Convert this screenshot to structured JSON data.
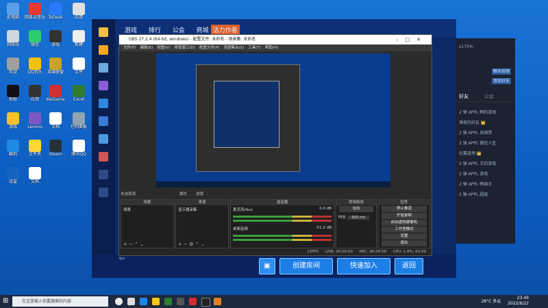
{
  "desktop": {
    "icons": [
      {
        "label": "此电脑",
        "color": "#5aa0e8"
      },
      {
        "label": "网易云音乐",
        "color": "#e53935"
      },
      {
        "label": "ToDesk",
        "color": "#2979ff"
      },
      {
        "label": "应用",
        "color": "#e0e0e0"
      },
      {
        "label": "回收站",
        "color": "#cfd8dc"
      },
      {
        "label": "微信",
        "color": "#2ecc71"
      },
      {
        "label": "游戏",
        "color": "#333"
      },
      {
        "label": "新建",
        "color": "#eee"
      },
      {
        "label": "欢迎",
        "color": "#9e9e9e"
      },
      {
        "label": "QQ音乐",
        "color": "#f4c20d"
      },
      {
        "label": "英雄联盟",
        "color": "#c9a227"
      },
      {
        "label": "文件",
        "color": "#fff"
      },
      {
        "label": "剪映",
        "color": "#111"
      },
      {
        "label": "应用",
        "color": "#333"
      },
      {
        "label": "WeGame",
        "color": "#d32f2f"
      },
      {
        "label": "Excel",
        "color": "#2e7d32"
      },
      {
        "label": "游戏",
        "color": "#fbc02d"
      },
      {
        "label": "Lenovo",
        "color": "#7e57c2"
      },
      {
        "label": "文档",
        "color": "#fff"
      },
      {
        "label": "控制面板",
        "color": "#90a4ae"
      },
      {
        "label": "酷狗",
        "color": "#1e88e5"
      },
      {
        "label": "文件夹",
        "color": "#fdd835"
      },
      {
        "label": "Steam",
        "color": "#263238"
      },
      {
        "label": "腾讯QQ",
        "color": "#fff"
      },
      {
        "label": "迅雷",
        "color": "#1565c0"
      },
      {
        "label": "文档",
        "color": "#fff"
      }
    ]
  },
  "game": {
    "tabs": [
      "游戏",
      "排行",
      "公会",
      "商城"
    ],
    "banner": "活力作者",
    "buttons": {
      "create_room": "创建房间",
      "quick_join": "快速加入",
      "back": "返回"
    }
  },
  "right_panel": {
    "button1": "聊天权限",
    "button2": "添加好友",
    "tab1": "好友",
    "tab2": "公会",
    "percent": "x175%",
    "rows": [
      "2 弹 APPL 韩的游戏",
      "渔家的好友 👑",
      "2 弹 APPL 吴国带",
      "2 弹 APPL 微信人区",
      "比赛进场 👑",
      "2 弹 APPL 王的游戏",
      "2 弹 APPL 游戏",
      "2 弹 APPL 韩国王",
      "2 弹 APPL 超级"
    ]
  },
  "obs": {
    "title": "OBS 27.2.4 (64-bit, windows) - 配置文件: 未命名 - 场景集: 未命名",
    "menu": [
      "文件(F)",
      "编辑(E)",
      "视图(V)",
      "停靠窗口(D)",
      "配置文件(P)",
      "场景集合(S)",
      "工具(T)",
      "帮助(H)"
    ],
    "no_source": "未选择源",
    "props": "属性",
    "filters": "滤镜",
    "docks": {
      "scenes": {
        "header": "场景",
        "item": "场景"
      },
      "sources": {
        "header": "来源",
        "item": "显示器采集"
      },
      "mixer": {
        "header": "混音器",
        "ch1": "麦克风/Aux",
        "ch1_db": "0.0 dB",
        "ch2": "桌面音频",
        "ch2_db": "-51.2 dB"
      },
      "transitions": {
        "header": "转场特效",
        "mode": "淡出",
        "duration_label": "时长",
        "duration": "300 ms"
      },
      "controls": {
        "header": "控件",
        "buttons": [
          "停止推流",
          "开始录制",
          "启动虚拟摄像机",
          "工作室模式",
          "设置",
          "退出"
        ]
      }
    },
    "status": {
      "live": "LIVE: 00:00:00",
      "rec": "REC: 00:00:00",
      "cpu": "CPU: 1.8%, 60.00 fps",
      "fps_label": "12FPS"
    }
  },
  "taskbar": {
    "search_placeholder": "在这里输入你要搜索的内容",
    "weather": "28°C 多云",
    "time": "23:49",
    "date": "2022/6/22"
  }
}
